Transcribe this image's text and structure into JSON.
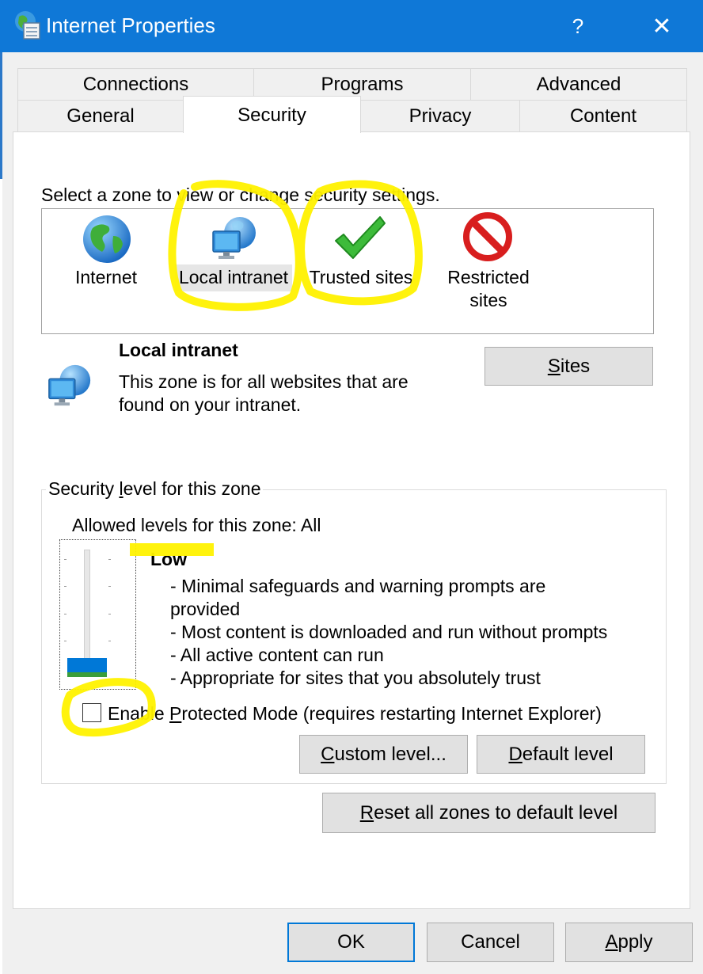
{
  "window": {
    "title": "Internet Properties",
    "help_glyph": "?",
    "close_glyph": "✕"
  },
  "tabs": {
    "row1": [
      "Connections",
      "Programs",
      "Advanced"
    ],
    "row2": [
      "General",
      "Security",
      "Privacy",
      "Content"
    ],
    "active": "Security"
  },
  "security": {
    "prompt": "Select a zone to view or change security settings.",
    "zones": [
      {
        "label": "Internet",
        "icon": "globe-icon"
      },
      {
        "label": "Local intranet",
        "icon": "intranet-computer-icon",
        "selected": true
      },
      {
        "label": "Trusted sites",
        "icon": "green-checkmark-icon"
      },
      {
        "label_line1": "Restricted",
        "label_line2": "sites",
        "icon": "red-prohibited-icon"
      }
    ],
    "selected_zone": {
      "name": "Local intranet",
      "description_line1": "This zone is for all websites that are",
      "description_line2": "found on your intranet.",
      "icon": "intranet-computer-icon"
    },
    "sites_button": {
      "accel": "S",
      "rest": "ites"
    },
    "level_group": {
      "title_pre": "Security ",
      "title_accel": "l",
      "title_post": "evel for this zone",
      "allowed": "Allowed levels for this zone: All",
      "level_name": "Low",
      "bullets": [
        "- Minimal safeguards and warning prompts are",
        "provided",
        "- Most content is downloaded and run without prompts",
        "- All active content can run",
        "- Appropriate for sites that you absolutely trust"
      ],
      "slider_level": "Low"
    },
    "protected_mode": {
      "pre": "Enable ",
      "accel": "P",
      "post": "rotected Mode (requires restarting Internet Explorer)",
      "checked": false
    },
    "custom_level_button": {
      "accel": "C",
      "rest": "ustom level..."
    },
    "default_level_button": {
      "accel": "D",
      "rest": "efault level"
    },
    "reset_button": {
      "accel": "R",
      "rest": "eset all zones to default level"
    }
  },
  "footer": {
    "ok": "OK",
    "cancel": "Cancel",
    "apply_accel": "A",
    "apply_rest": "pply"
  },
  "colors": {
    "titlebar": "#0f78d7",
    "highlighter": "#fff200",
    "slider_thumb": "#0078d7"
  }
}
